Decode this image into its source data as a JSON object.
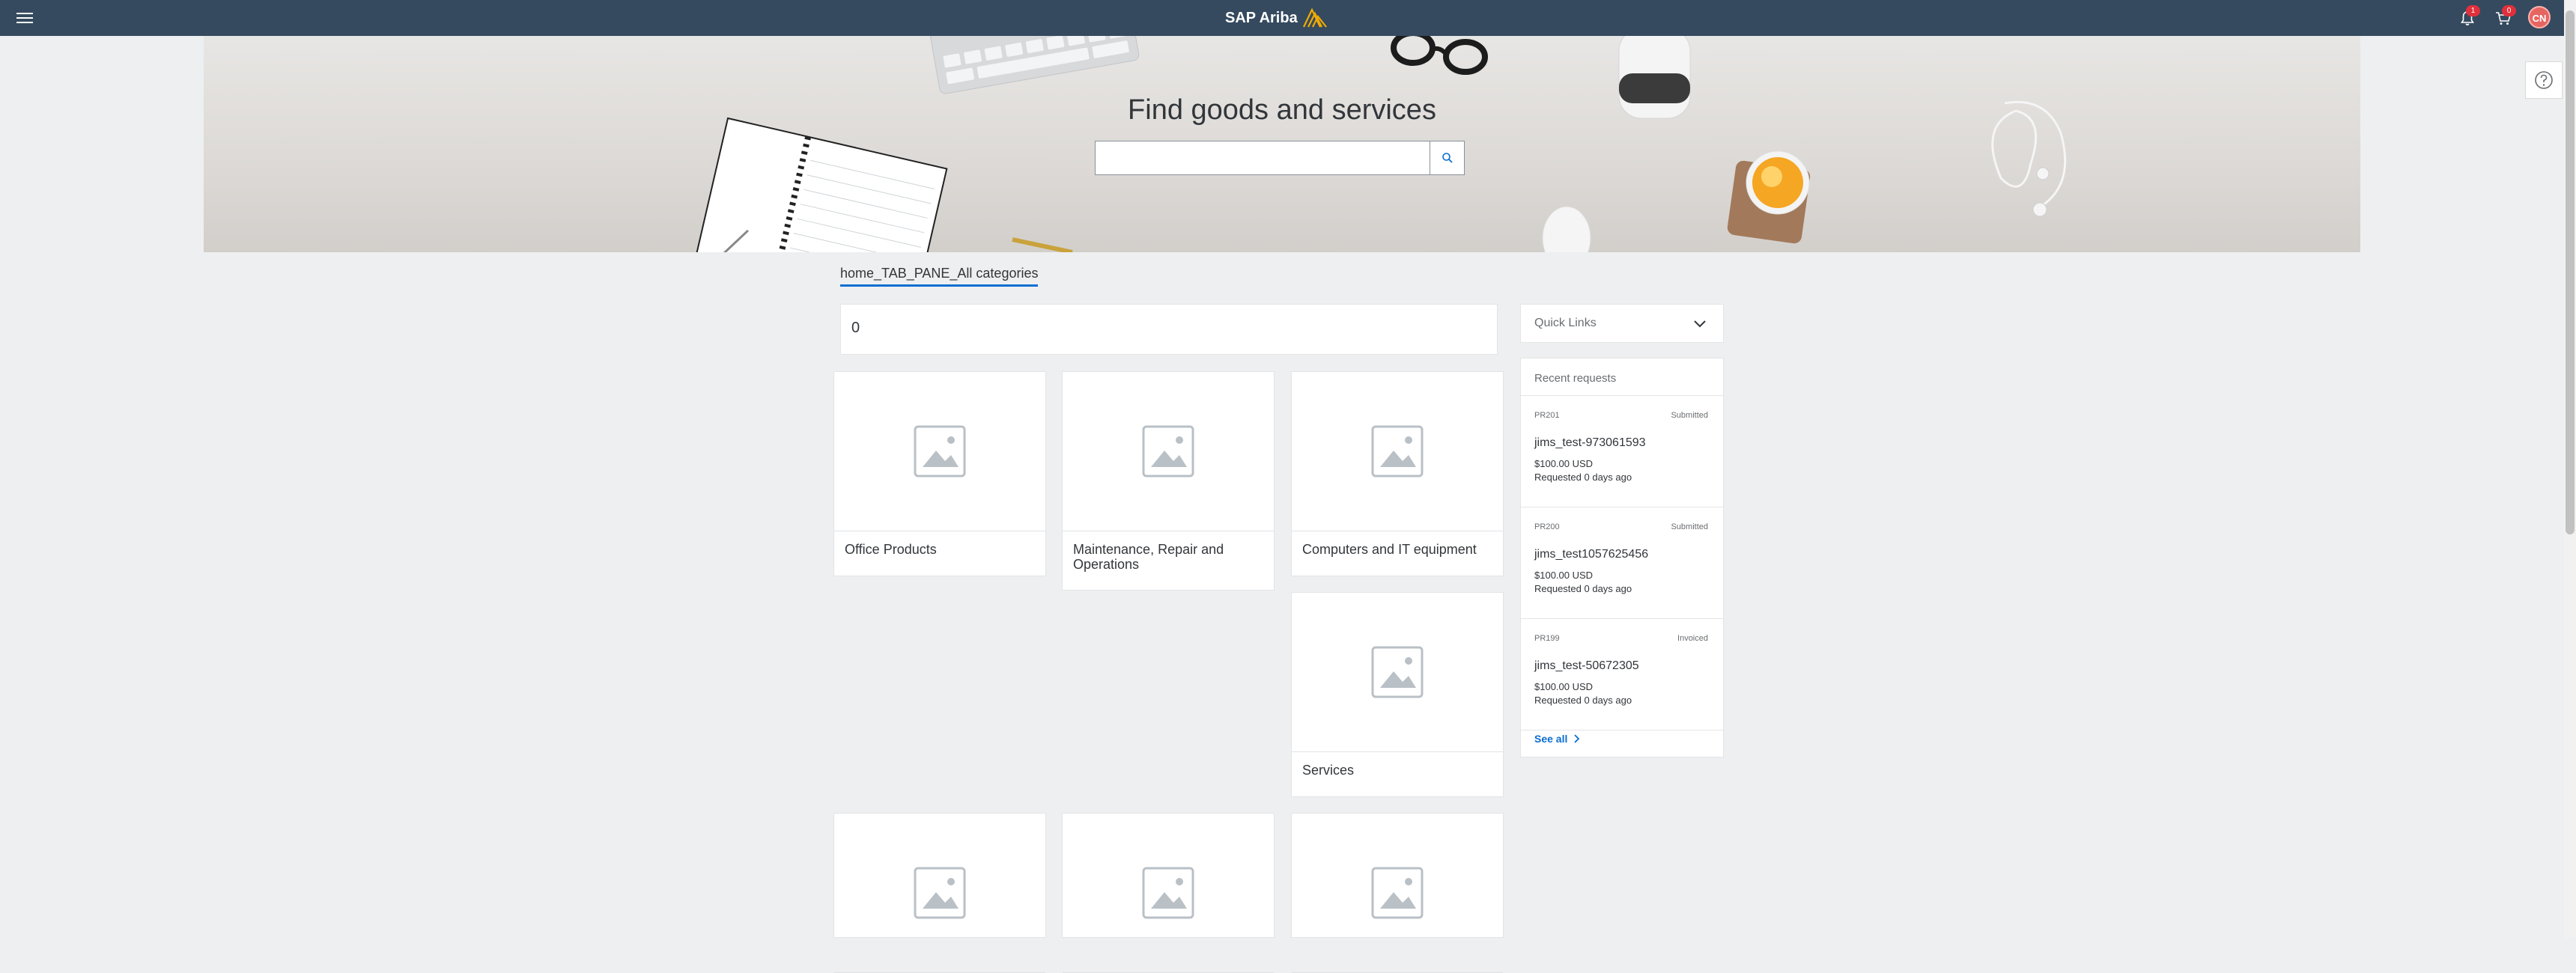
{
  "topbar": {
    "brand": "SAP Ariba",
    "notifications_count": "1",
    "cart_count": "0",
    "avatar_initials": "CN"
  },
  "hero": {
    "title": "Find goods and services",
    "search_value": ""
  },
  "tabs": {
    "active": "home_TAB_PANE_All categories"
  },
  "filter": {
    "value": "0"
  },
  "tiles": [
    {
      "label": "Office Products"
    },
    {
      "label": "Maintenance, Repair and Operations"
    },
    {
      "label": "Computers and IT equipment"
    },
    {
      "label": "Services"
    }
  ],
  "quick_links": {
    "label": "Quick Links"
  },
  "recent_requests": {
    "title": "Recent requests",
    "items": [
      {
        "id": "PR201",
        "status": "Submitted",
        "name": "jims_test-973061593",
        "amount": "$100.00 USD",
        "date": "Requested 0 days ago"
      },
      {
        "id": "PR200",
        "status": "Submitted",
        "name": "jims_test1057625456",
        "amount": "$100.00 USD",
        "date": "Requested 0 days ago"
      },
      {
        "id": "PR199",
        "status": "Invoiced",
        "name": "jims_test-50672305",
        "amount": "$100.00 USD",
        "date": "Requested 0 days ago"
      }
    ],
    "see_all": "See all"
  },
  "colors": {
    "topbar": "#354a5f",
    "accent": "#0a6ed1",
    "badge": "#e0303b",
    "background": "#edeff0"
  }
}
